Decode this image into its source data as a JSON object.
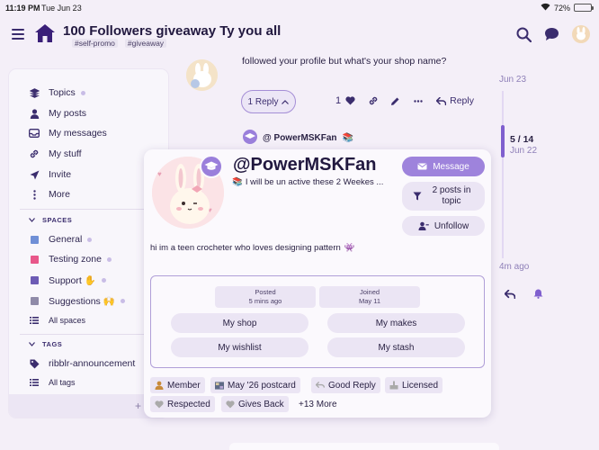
{
  "status_bar": {
    "time": "11:19 PM",
    "date": "Tue Jun 23",
    "battery": "72%"
  },
  "header": {
    "title": "100 Followers giveaway Ty you all",
    "tags": [
      "#self-promo",
      "#giveaway"
    ]
  },
  "sidebar": {
    "items": [
      {
        "label": "Topics",
        "icon": "layers-icon"
      },
      {
        "label": "My posts",
        "icon": "user-icon"
      },
      {
        "label": "My messages",
        "icon": "inbox-icon"
      },
      {
        "label": "My stuff",
        "icon": "link-icon"
      },
      {
        "label": "Invite",
        "icon": "send-icon"
      },
      {
        "label": "More",
        "icon": "more-vertical-icon"
      }
    ],
    "spaces_heading": "SPACES",
    "spaces": [
      {
        "label": "General",
        "color": "#6f8fd6"
      },
      {
        "label": "Testing zone",
        "color": "#e8578a"
      },
      {
        "label": "Support ✋",
        "color": "#6d5bb5"
      },
      {
        "label": "Suggestions 🙌",
        "color": "#8f8aa8"
      }
    ],
    "all_spaces": "All spaces",
    "tags_heading": "TAGS",
    "tags": [
      {
        "label": "ribblr-announcement"
      }
    ],
    "all_tags": "All tags"
  },
  "post": {
    "text": "followed your profile but what's your shop name?",
    "reply_count_label": "1 Reply",
    "like_count": "1",
    "reply_label": "Reply"
  },
  "reply_preview": {
    "username": "@ PowerMSKFan",
    "emoji": "📚"
  },
  "timeline": {
    "top_date": "Jun 23",
    "position": "5 / 14",
    "date": "Jun 22",
    "ago": "4m ago"
  },
  "user_card": {
    "username": "@PowerMSKFan",
    "status": "I will be un active these 2 Weekes ...",
    "status_emoji": "📚",
    "bio": "hi im a teen crocheter who loves designing pattern",
    "bio_emoji": "👾",
    "message_label": "Message",
    "posts_in_topic": "2 posts in topic",
    "unfollow_label": "Unfollow",
    "posted_label": "Posted",
    "posted_value": "5 mins ago",
    "joined_label": "Joined",
    "joined_value": "May 11",
    "links": [
      "My shop",
      "My makes",
      "My wishlist",
      "My stash"
    ],
    "badges": [
      "Member",
      "May '26 postcard",
      "Good Reply",
      "Licensed",
      "Respected",
      "Gives Back",
      "+13 More"
    ]
  },
  "colors": {
    "accent": "#9e83dc",
    "text": "#2a2244",
    "muted": "#8f80b8"
  }
}
